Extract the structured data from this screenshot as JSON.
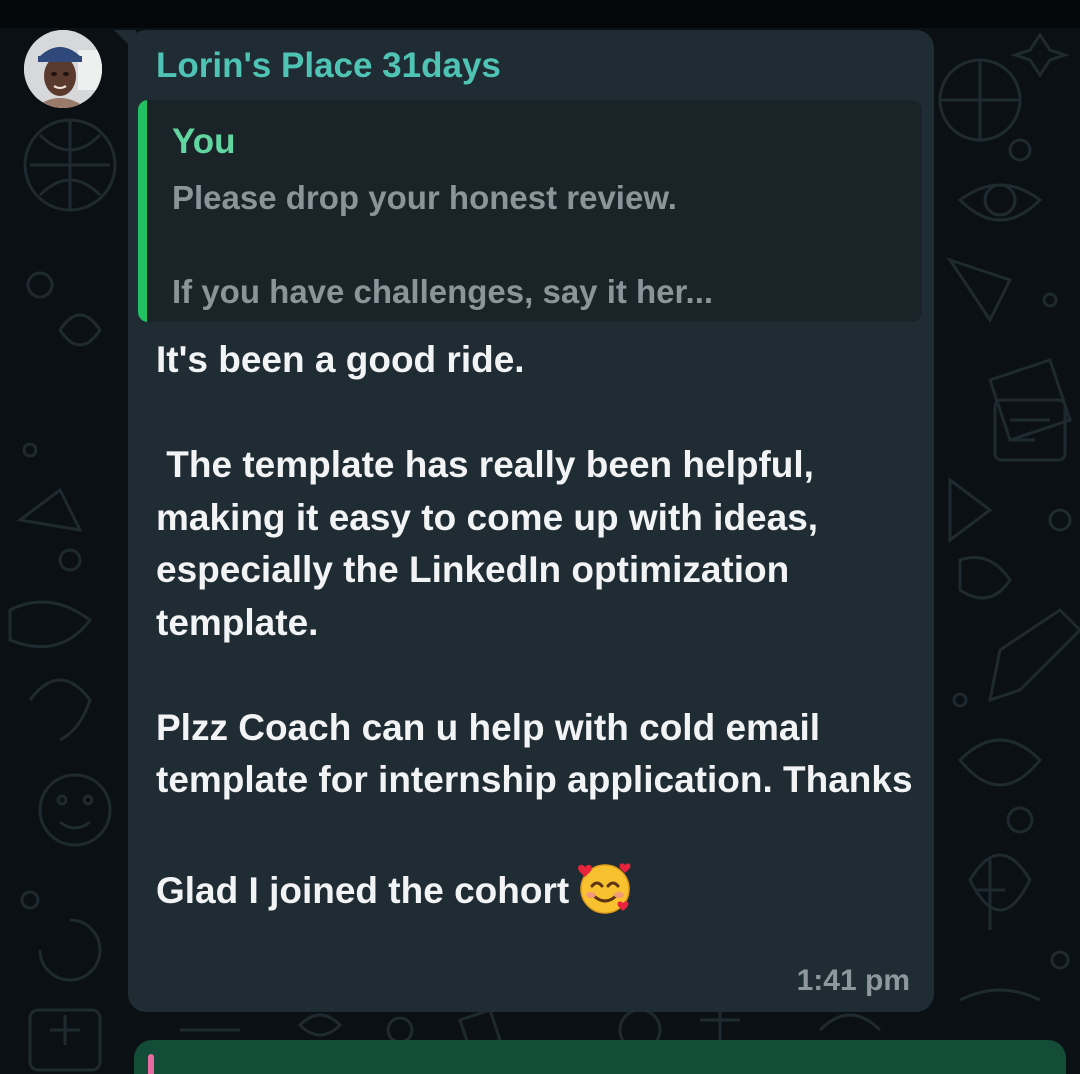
{
  "message": {
    "sender_name": "Lorin's Place 31days",
    "quoted": {
      "author": "You",
      "text": "Please drop your honest review.\n\nIf you have challenges, say it her..."
    },
    "body": "It's been a good ride.\n\n The template has really been helpful, making it easy to come up with ideas, especially the LinkedIn optimization template.\n\nPlzz Coach can u help with cold email template for internship application. Thanks\n\nGlad I joined the cohort",
    "emoji": "smiling-face-with-hearts-icon",
    "time": "1:41 pm"
  },
  "colors": {
    "chat_background": "#0b1014",
    "bubble": "#202c33",
    "sender_name": "#4fc4b5",
    "quote_bar": "#21c063",
    "quote_author": "#62d6a0",
    "outgoing_bubble": "#134d37"
  }
}
